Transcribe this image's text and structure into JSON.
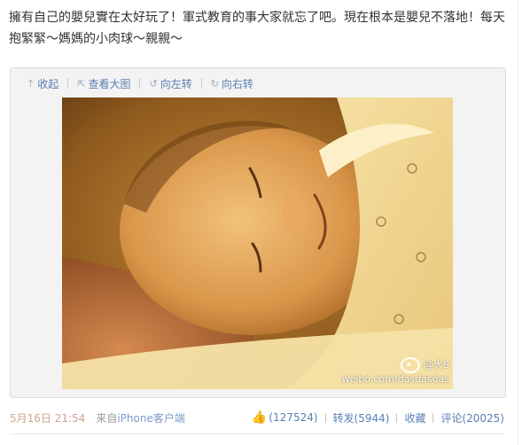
{
  "post": {
    "text": "擁有自己的嬰兒實在太好玩了！軍式教育的事大家就忘了吧。現在根本是嬰兒不落地！每天抱緊緊～媽媽的小肉球～親親～"
  },
  "toolbar": {
    "collapse_label": "收起",
    "collapse_icon": "up-arrow-icon",
    "view_large_label": "查看大图",
    "view_large_icon": "external-link-icon",
    "rotate_left_label": "向左转",
    "rotate_left_icon": "rotate-left-icon",
    "rotate_right_label": "向右转",
    "rotate_right_icon": "rotate-right-icon"
  },
  "photo": {
    "watermark_user": "@大S",
    "watermark_url": "weibo.com/dasdasdas",
    "watermark_icon": "weibo-logo-icon"
  },
  "footer": {
    "time": "5月16日 21:54",
    "from_label": "来自",
    "client": "iPhone客户端",
    "like_icon": "thumbs-up-icon",
    "like_count": "(127524)",
    "repost_label": "转发(5944)",
    "favorite_label": "收藏",
    "comment_label": "评论(20025)"
  },
  "colors": {
    "link": "#5a7fb5",
    "time": "#d2a392",
    "muted": "#9a9a9a",
    "media_bg": "#f3f3f3"
  }
}
